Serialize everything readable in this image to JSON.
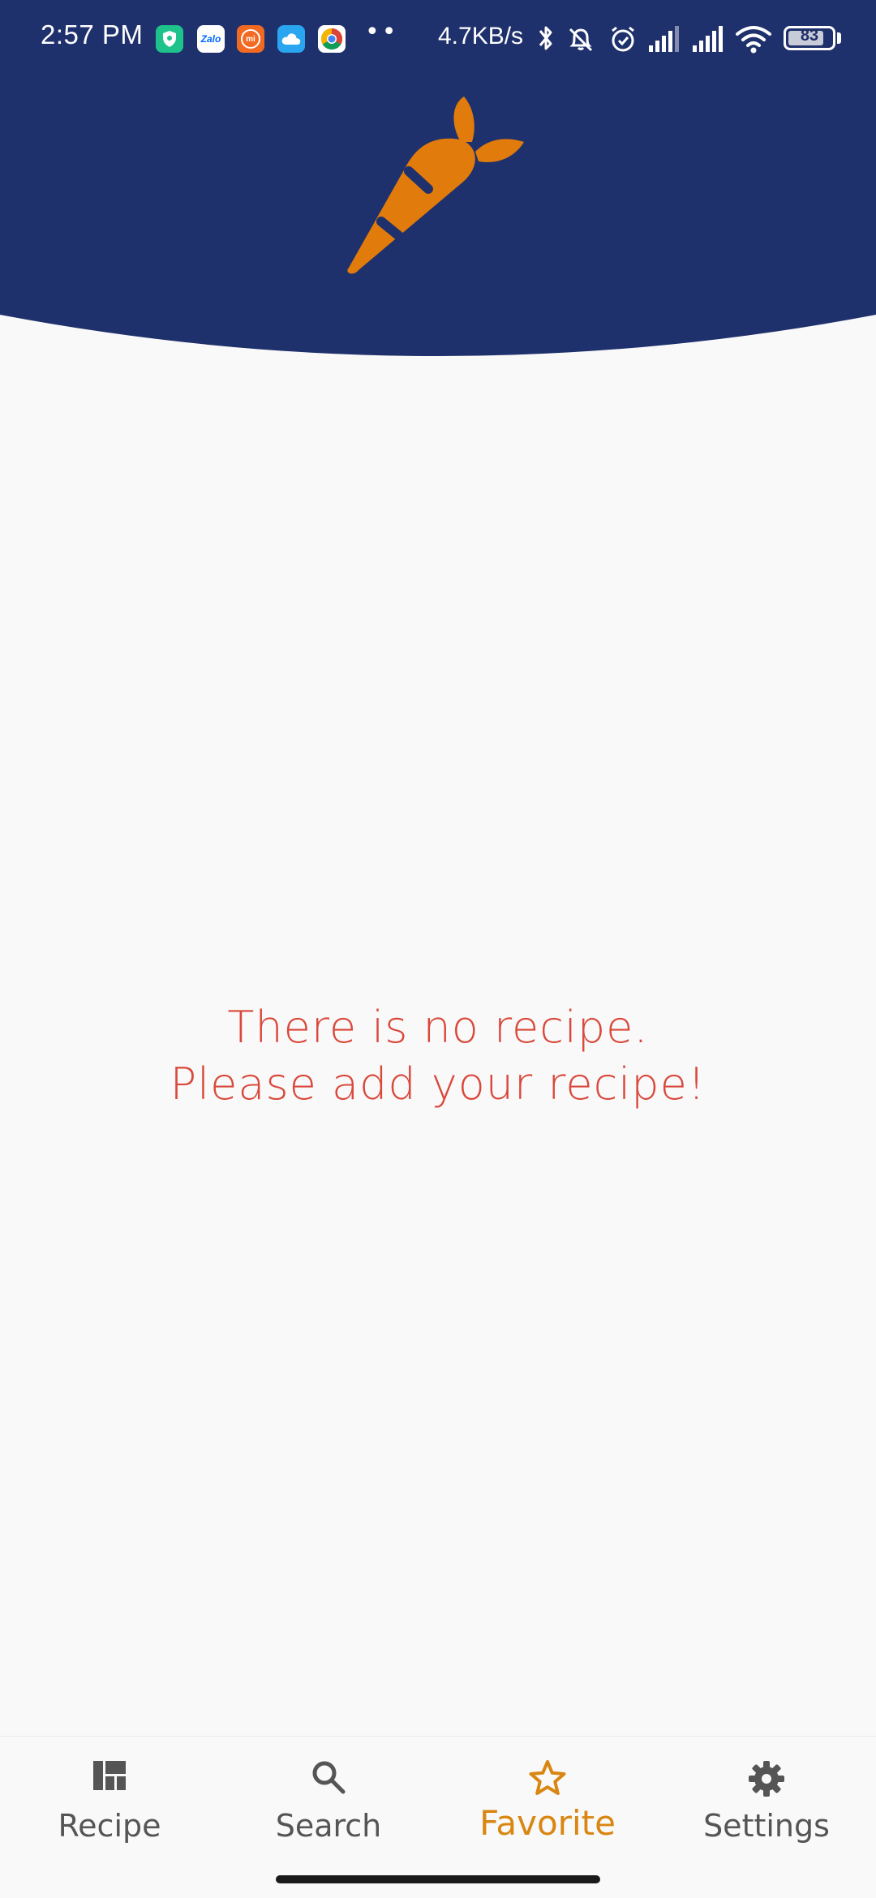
{
  "colors": {
    "header_bg": "#1f316c",
    "accent": "#d98612",
    "logo": "#e07b0c",
    "message": "#d9483b",
    "nav_inactive": "#555555"
  },
  "status_bar": {
    "time": "2:57 PM",
    "notification_icons": [
      "shield-icon",
      "zalo-icon",
      "mi-icon",
      "cloud-icon",
      "chrome-icon"
    ],
    "zalo_text": "Zalo",
    "mi_text": "mi",
    "more_dots": "••",
    "net_speed": "4.7KB/s",
    "battery_level": "83",
    "battery_fraction": 0.83
  },
  "header": {
    "logo_icon": "carrot-icon"
  },
  "empty_state": {
    "line1": "There is no recipe.",
    "line2": "Please add your recipe!"
  },
  "bottom_nav": {
    "items": [
      {
        "label": "Recipe",
        "icon": "dashboard-icon",
        "active": false
      },
      {
        "label": "Search",
        "icon": "search-icon",
        "active": false
      },
      {
        "label": "Favorite",
        "icon": "star-icon",
        "active": true
      },
      {
        "label": "Settings",
        "icon": "gear-icon",
        "active": false
      }
    ]
  }
}
